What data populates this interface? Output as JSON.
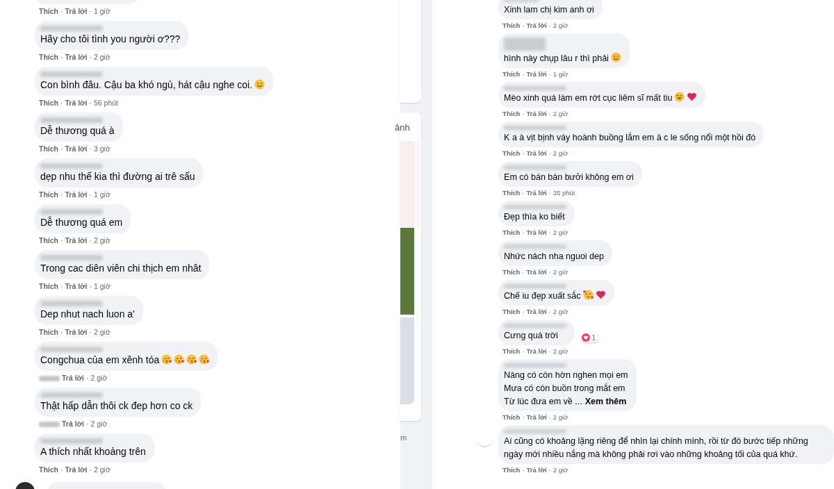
{
  "separator": "·",
  "left_column": {
    "top_actions": {
      "like_blurred": false,
      "like": "Thích",
      "reply": "Trả lời",
      "time": "1 giờ"
    },
    "comments": [
      {
        "text": "Hãy cho tôi tình you người ơ???",
        "like_blurred": false,
        "like": "Thích",
        "reply": "Trả lời",
        "time": "2 giờ"
      },
      {
        "text": "Con bình đâu. Cậu ba khó ngủ, hát cậu nghe coi.",
        "emojis": [
          {
            "kind": "smile"
          }
        ],
        "like_blurred": false,
        "like": "Thích",
        "reply": "Trả lời",
        "time": "56 phút"
      },
      {
        "text": "Dễ thương quá à",
        "like_blurred": false,
        "like": "Thích",
        "reply": "Trả lời",
        "time": "3 giờ"
      },
      {
        "text": "dẹp nhu thế kia thì đường ai trê sấu",
        "like_blurred": false,
        "like": "Thích",
        "reply": "Trả lời",
        "time": "1 giờ"
      },
      {
        "text": "Dễ thương quá em",
        "like_blurred": false,
        "like": "Thích",
        "reply": "Trả lời",
        "time": "2 giờ"
      },
      {
        "text": "Trong cac diên viên chi thịch em nhât",
        "like_blurred": false,
        "like": "Thích",
        "reply": "Trả lời",
        "time": "1 giờ"
      },
      {
        "text": "Dep nhut nach luon a'",
        "like_blurred": false,
        "like": "Thích",
        "reply": "Trả lời",
        "time": "2 giờ"
      },
      {
        "text": "Congchua của em xênh tóa",
        "emojis": [
          {
            "kind": "kiss"
          },
          {
            "kind": "kiss"
          },
          {
            "kind": "kiss"
          },
          {
            "kind": "kiss"
          }
        ],
        "like_blurred": true,
        "reply": "Trả lời",
        "time": "2 giờ"
      },
      {
        "text": "Thật hấp dẫn thôi ck đep hơn co ck",
        "like_blurred": true,
        "reply": "Trả lời",
        "time": "2 giờ"
      },
      {
        "text": "A thích nhất khoảng trên",
        "like_blurred": false,
        "like": "Thích",
        "reply": "Trả lời",
        "time": "2 giờ"
      }
    ],
    "trailing_avatar": true
  },
  "middle_strip": {
    "link": "ảnh",
    "caption": "m"
  },
  "right_column": {
    "comments": [
      {
        "name_cut": true,
        "text": "Xinh lam chị kim anh ơi",
        "like_blurred": false,
        "like": "Thích",
        "reply": "Trả lời",
        "time": "2 giờ"
      },
      {
        "two_line_name": true,
        "text": "hình này chụp lâu r thì phải",
        "emojis": [
          {
            "kind": "smile"
          }
        ],
        "like_blurred": false,
        "like": "Thích",
        "reply": "Trả lời",
        "time": "1 giờ"
      },
      {
        "text": "Mèo xinh quá làm em rớt cục liêm sĩ mất tiu",
        "emojis": [
          {
            "kind": "grin"
          },
          {
            "kind": "heart"
          }
        ],
        "like_blurred": false,
        "like": "Thích",
        "reply": "Trả lời",
        "time": "2 giờ"
      },
      {
        "text": "K a à vịt bịnh váy hoành buồng lắm em à c le sống nổi một hồi đó",
        "like_blurred": false,
        "like": "Thích",
        "reply": "Trả lời",
        "time": "2 giờ"
      },
      {
        "text": "Em có bán bán bưởi không em ơi",
        "like_blurred": false,
        "like": "Thích",
        "reply": "Trả lời",
        "time": "35 phút"
      },
      {
        "text": "Đẹp thìa ko biết",
        "like_blurred": false,
        "like": "Thích",
        "reply": "Trả lời",
        "time": "2 giờ"
      },
      {
        "text": "Nhức nách nha nguoi dep",
        "like_blurred": false,
        "like": "Thích",
        "reply": "Trả lời",
        "time": "2 giờ"
      },
      {
        "text": "Chế iu đẹp xuất sắc",
        "emojis": [
          {
            "kind": "hearts-face"
          },
          {
            "kind": "heart"
          }
        ],
        "like_blurred": false,
        "like": "Thích",
        "reply": "Trả lời",
        "time": "2 giờ"
      },
      {
        "text": "Cưng quá trời",
        "reaction_count": "1",
        "like_blurred": false,
        "like": "Thích",
        "reply": "Trả lời",
        "time": "2 giờ"
      },
      {
        "lines": [
          "Nàng có còn hờn nghen mọi em",
          "Mưa có còn buồn trong mắt em",
          "Từ lúc đưa em về ..."
        ],
        "see_more": "Xem thêm",
        "like_blurred": false,
        "like": "Thích",
        "reply": "Trả lời",
        "time": "2 giờ"
      },
      {
        "text": "Ai cũng có khoảng lặng riêng để nhìn lại chính mình, rồi từ đó bước tiếp những ngày mới nhiều nắng mà không phải rơi vào những khoảng tối của quá khứ.",
        "avatar": true,
        "like_blurred": false,
        "like": "Thích",
        "reply": "Trả lời",
        "time": "2 giờ"
      }
    ]
  }
}
